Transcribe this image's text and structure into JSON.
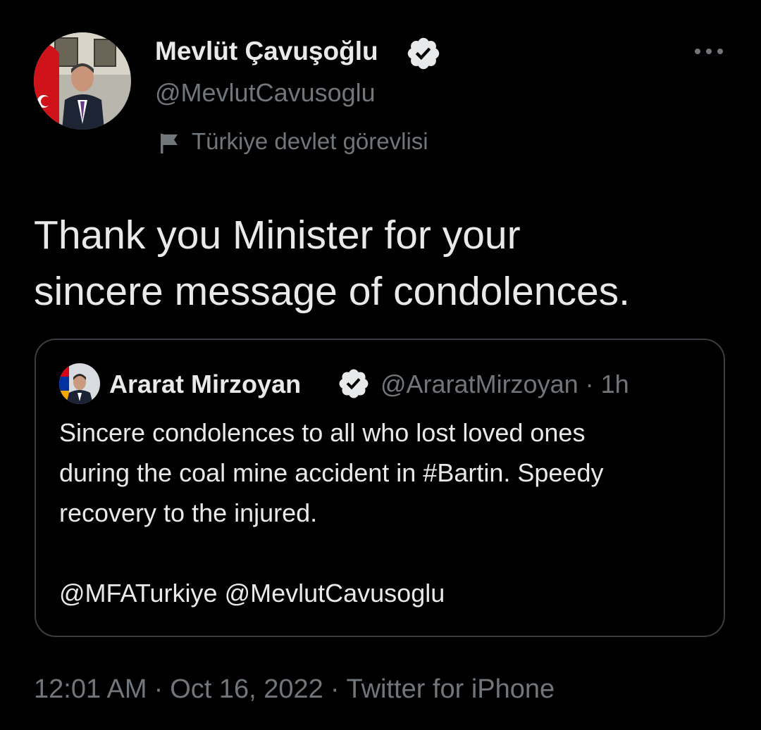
{
  "tweet": {
    "author": {
      "display_name": "Mevlüt Çavuşoğlu",
      "handle": "@MevlutCavusoglu",
      "verified_icon": "verified-badge-icon",
      "label_icon": "flag-icon",
      "affiliation_label": "Türkiye devlet görevlisi"
    },
    "more_icon": "more-horizontal-icon",
    "text_line1": "Thank you Minister for your",
    "text_line2": "sincere message of condolences.",
    "quoted": {
      "display_name": "Ararat Mirzoyan",
      "handle": "@AraratMirzoyan",
      "separator": "·",
      "age": "1h",
      "text_line1": "Sincere condolences to all who lost loved ones",
      "text_line2": "during the coal mine accident in #Bartin. Speedy",
      "text_line3": "recovery to the injured.",
      "mentions": "@MFATurkiye @MevlutCavusoglu"
    },
    "footer": {
      "time": "12:01 AM",
      "separator": "·",
      "date": "Oct 16, 2022",
      "source": "Twitter for iPhone"
    }
  },
  "colors": {
    "background": "#000000",
    "primary_text": "#e7e9ea",
    "secondary_text": "#71767b",
    "border": "#3a3d41",
    "badge_fill": "#e7e9ea",
    "badge_check": "#000000"
  }
}
